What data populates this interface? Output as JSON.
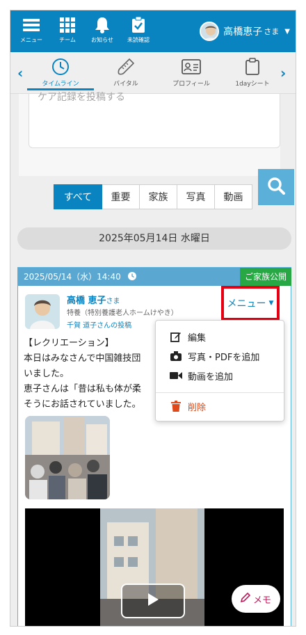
{
  "topnav": {
    "items": [
      {
        "label": "メニュー",
        "icon": "hamburger-icon"
      },
      {
        "label": "チーム",
        "icon": "grid-icon"
      },
      {
        "label": "お知らせ",
        "icon": "bell-icon"
      },
      {
        "label": "未読確認",
        "icon": "clipboard-check-icon"
      }
    ],
    "user_name": "高橋恵子",
    "user_suffix": "さま"
  },
  "tabs": {
    "items": [
      {
        "label": "タイムライン",
        "icon": "clock-icon"
      },
      {
        "label": "バイタル",
        "icon": "thermometer-icon"
      },
      {
        "label": "プロフィール",
        "icon": "profile-card-icon"
      },
      {
        "label": "1dayシート",
        "icon": "clipboard-icon"
      }
    ],
    "active_index": 0
  },
  "compose": {
    "placeholder": "ケア記録を投稿する"
  },
  "filters": [
    "すべて",
    "重要",
    "家族",
    "写真",
    "動画"
  ],
  "date_label": "2025年05月14日 水曜日",
  "post": {
    "timestamp": "2025/05/14（水）14:40",
    "visibility": "ご家族公開",
    "author": "高橋 恵子",
    "author_suffix": "さま",
    "organization": "特養（特別養護老人ホームけやき）",
    "posted_by": "千賀 道子さんの投稿",
    "body": [
      "【レクリエーション】",
      "本日はみなさんで中国雑技団",
      "いました。",
      "恵子さんは「昔は私も体が柔",
      "そうにお話されていました。"
    ],
    "menu_label": "メニュー",
    "memo_label": "メモ"
  },
  "dropdown": {
    "items": [
      {
        "label": "編集",
        "icon": "edit-icon"
      },
      {
        "label": "写真・PDFを追加",
        "icon": "camera-icon"
      },
      {
        "label": "動画を追加",
        "icon": "video-camera-icon"
      },
      {
        "label": "削除",
        "icon": "trash-icon"
      }
    ]
  },
  "colors": {
    "primary": "#0a84c1",
    "highlight": "#e60012",
    "public_badge": "#28a745",
    "danger": "#e04a1a"
  }
}
